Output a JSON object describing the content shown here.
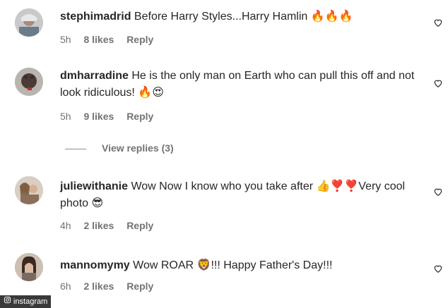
{
  "comments": [
    {
      "username": "stephimadrid",
      "text": "Before Harry Styles...Harry Hamlin 🔥🔥🔥",
      "time": "5h",
      "likes": "8 likes",
      "reply": "Reply"
    },
    {
      "username": "dmharradine",
      "text": "He is the only man on Earth who can pull this off and not look ridiculous! 🔥😍",
      "time": "5h",
      "likes": "9 likes",
      "reply": "Reply"
    },
    {
      "username": "juliewithanie",
      "text": "Wow Now I know who you take after 👍❣️❣️Very cool photo 😎",
      "time": "4h",
      "likes": "2 likes",
      "reply": "Reply"
    },
    {
      "username": "mannomymy",
      "text": "Wow ROAR 🦁!!! Happy Father's Day!!!",
      "time": "6h",
      "likes": "2 likes",
      "reply": "Reply"
    }
  ],
  "view_replies": "View replies (3)",
  "watermark": "instagram",
  "icons": {
    "like": "heart-outline-icon",
    "watermark": "camera-icon"
  },
  "colors": {
    "text": "#262626",
    "meta": "#737373",
    "watermark_bg": "#3a3a3a"
  }
}
